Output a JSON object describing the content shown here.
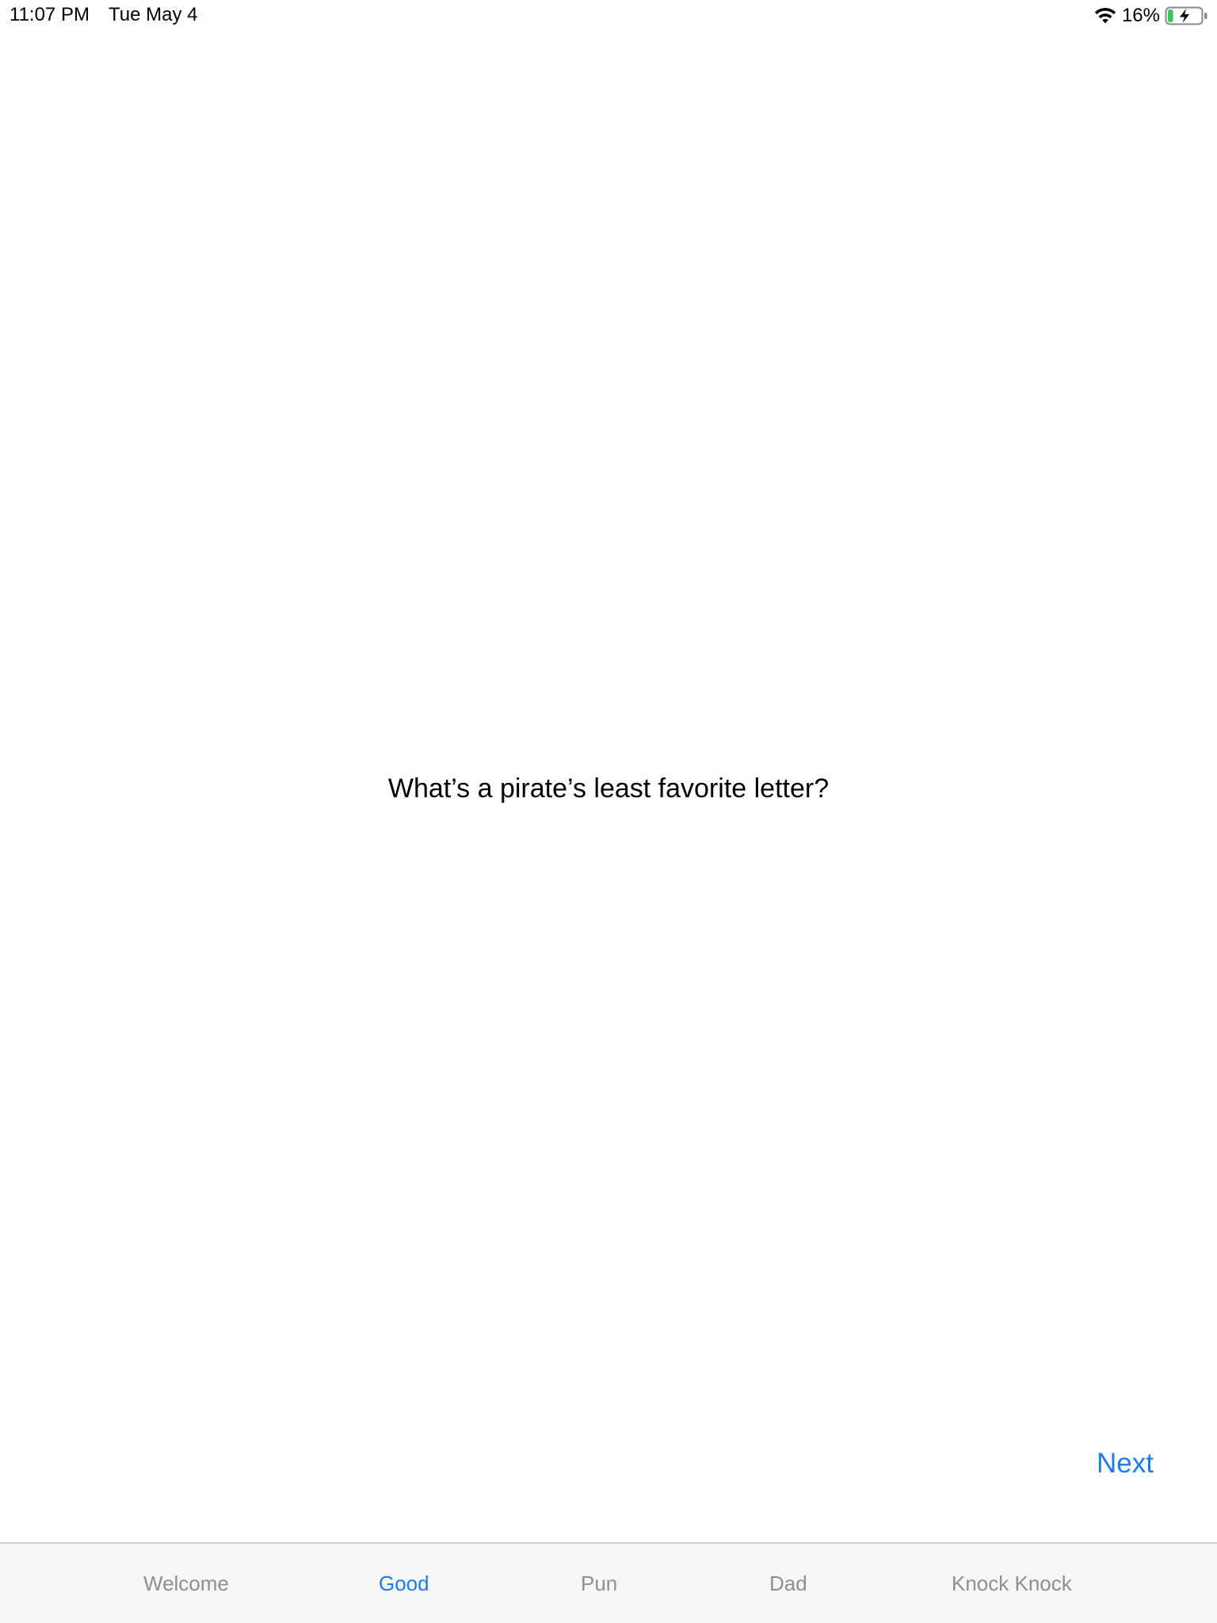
{
  "status_bar": {
    "time": "11:07 PM",
    "date": "Tue May 4",
    "battery_percent": "16%",
    "wifi_icon": "wifi-icon",
    "battery_icon": "battery-charging-icon",
    "battery_level": 0.16,
    "battery_color": "#34c759"
  },
  "main": {
    "joke_text": "What’s a pirate’s least favorite letter?",
    "next_label": "Next"
  },
  "tab_bar": {
    "active_color": "#1e7bea",
    "inactive_color": "#8e8e93",
    "items": [
      {
        "label": "Welcome",
        "active": false
      },
      {
        "label": "Good",
        "active": true
      },
      {
        "label": "Pun",
        "active": false
      },
      {
        "label": "Dad",
        "active": false
      },
      {
        "label": "Knock Knock",
        "active": false
      }
    ]
  }
}
